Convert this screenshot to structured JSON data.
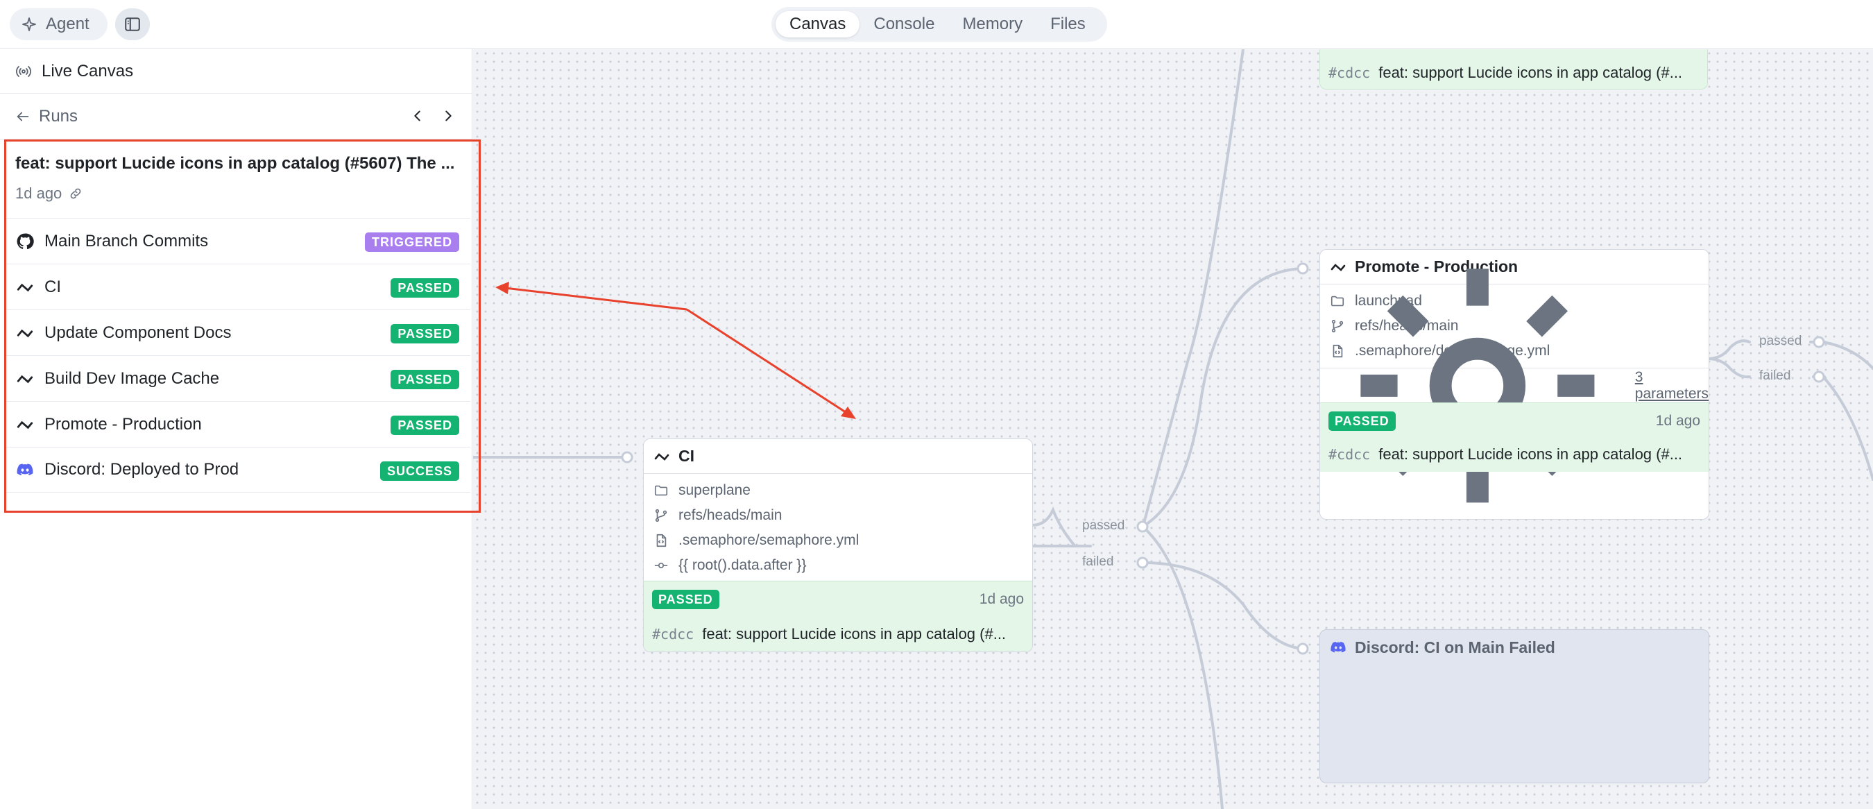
{
  "topbar": {
    "agent_label": "Agent",
    "tabs": [
      "Canvas",
      "Console",
      "Memory",
      "Files"
    ],
    "active_tab": "Canvas"
  },
  "sidebar": {
    "live_canvas_label": "Live Canvas",
    "runs_label": "Runs",
    "run": {
      "title": "feat: support Lucide icons in app catalog (#5607) The ...",
      "time": "1d ago",
      "steps": [
        {
          "label": "Main Branch Commits",
          "status": "TRIGGERED",
          "icon": "github-icon",
          "color": "#a97ff0"
        },
        {
          "label": "CI",
          "status": "PASSED",
          "icon": "semaphore-icon",
          "color": "#15b371"
        },
        {
          "label": "Update Component Docs",
          "status": "PASSED",
          "icon": "semaphore-icon",
          "color": "#15b371"
        },
        {
          "label": "Build Dev Image Cache",
          "status": "PASSED",
          "icon": "semaphore-icon",
          "color": "#15b371"
        },
        {
          "label": "Promote - Production",
          "status": "PASSED",
          "icon": "semaphore-icon",
          "color": "#15b371"
        },
        {
          "label": "Discord: Deployed to Prod",
          "status": "SUCCESS",
          "icon": "discord-icon",
          "color": "#15b371"
        }
      ]
    }
  },
  "canvas": {
    "top_node": {
      "hash": "#cdcc",
      "commit": "feat: support Lucide icons in app catalog (#..."
    },
    "ci_node": {
      "title": "CI",
      "project": "superplane",
      "ref": "refs/heads/main",
      "file": ".semaphore/semaphore.yml",
      "commit_expr": "{{ root().data.after }}",
      "status": "PASSED",
      "time": "1d ago",
      "hash": "#cdcc",
      "commit": "feat: support Lucide icons in app catalog (#..."
    },
    "promote_node": {
      "title": "Promote - Production",
      "project": "launchpad",
      "ref": "refs/heads/main",
      "file": ".semaphore/deploy-image.yml",
      "params": "3 parameters",
      "status": "PASSED",
      "time": "1d ago",
      "hash": "#cdcc",
      "commit": "feat: support Lucide icons in app catalog (#..."
    },
    "discord_node": {
      "title": "Discord: CI on Main Failed"
    },
    "ports": {
      "ci_passed": "passed",
      "ci_failed": "failed",
      "promote_passed": "passed",
      "promote_failed": "failed"
    }
  },
  "colors": {
    "passed_green": "#15b371",
    "triggered_purple": "#a97ff0",
    "annotation_red": "#e8412c",
    "discord_blurple": "#5865f2"
  }
}
